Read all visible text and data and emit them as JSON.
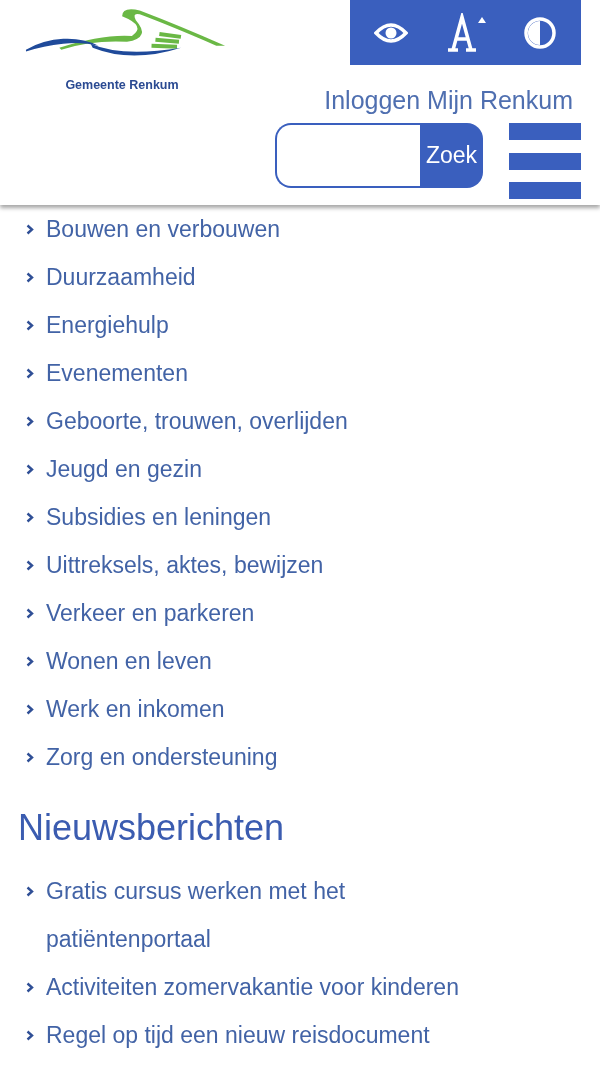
{
  "header": {
    "logo_text": "Gemeente Renkum",
    "login_link": "Inloggen Mijn Renkum",
    "search": {
      "button": "Zoek"
    }
  },
  "topics": [
    {
      "label": "Bouwen en verbouwen"
    },
    {
      "label": "Duurzaamheid"
    },
    {
      "label": "Energiehulp"
    },
    {
      "label": "Evenementen"
    },
    {
      "label": "Geboorte, trouwen, overlijden"
    },
    {
      "label": "Jeugd en gezin"
    },
    {
      "label": "Subsidies en leningen"
    },
    {
      "label": "Uittreksels, aktes, bewijzen"
    },
    {
      "label": "Verkeer en parkeren"
    },
    {
      "label": "Wonen en leven"
    },
    {
      "label": "Werk en inkomen"
    },
    {
      "label": "Zorg en ondersteuning"
    }
  ],
  "news": {
    "title": "Nieuwsberichten",
    "items": [
      {
        "label": "Gratis cursus werken met het patiëntenportaal"
      },
      {
        "label": "Activiteiten zomervakantie voor kinderen"
      },
      {
        "label": "Regel op tijd een nieuw reisdocument"
      }
    ]
  }
}
